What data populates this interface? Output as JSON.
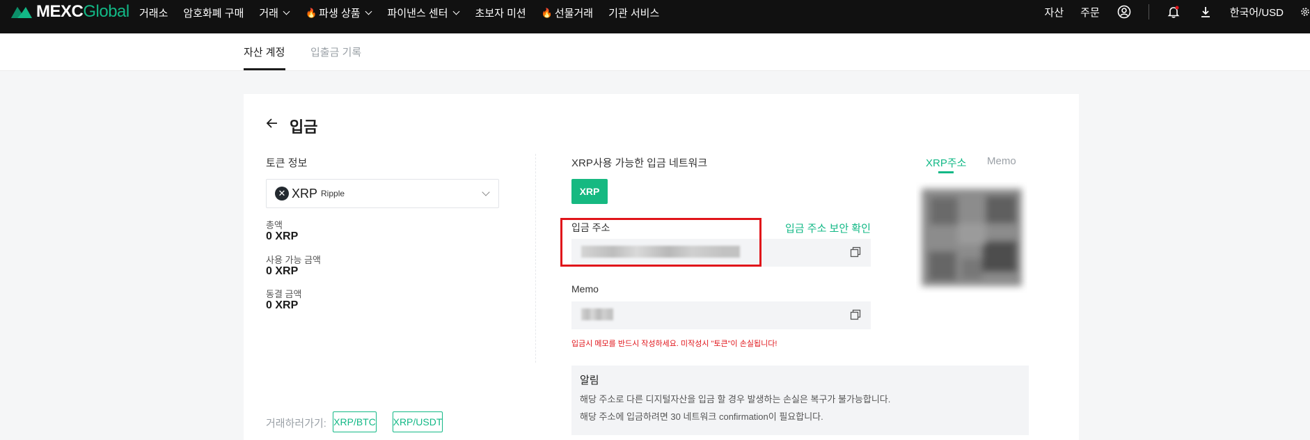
{
  "brand": {
    "name": "MEXC",
    "suffix": "Global"
  },
  "nav": {
    "items": [
      {
        "label": "거래소",
        "fire": false,
        "dropdown": false
      },
      {
        "label": "암호화폐 구매",
        "fire": false,
        "dropdown": false
      },
      {
        "label": "거래",
        "fire": false,
        "dropdown": true
      },
      {
        "label": "파생 상품",
        "fire": true,
        "dropdown": true
      },
      {
        "label": "파이낸스 센터",
        "fire": false,
        "dropdown": true
      },
      {
        "label": "초보자 미션",
        "fire": false,
        "dropdown": false
      },
      {
        "label": "선물거래",
        "fire": true,
        "dropdown": false
      },
      {
        "label": "기관 서비스",
        "fire": false,
        "dropdown": false
      }
    ],
    "right": {
      "assets": "자산",
      "orders": "주문",
      "lang_currency": "한국어/USD"
    }
  },
  "tabs": {
    "active": "자산 계정",
    "inactive": "입출금 기록"
  },
  "page": {
    "title": "입금",
    "token_info_label": "토큰 정보",
    "token": {
      "symbol": "XRP",
      "name": "Ripple"
    },
    "balances": [
      {
        "label": "총액",
        "value": "0 XRP"
      },
      {
        "label": "사용 가능 금액",
        "value": "0 XRP"
      },
      {
        "label": "동결 금액",
        "value": "0 XRP"
      }
    ],
    "trade": {
      "label": "거래하러가기:",
      "pairs": [
        "XRP/BTC",
        "XRP/USDT"
      ]
    },
    "network_label": "XRP사용 가능한 입금 네트워크",
    "network_button": "XRP",
    "address_label": "입금 주소",
    "verify_link": "입금 주소 보안 확인",
    "memo_label": "Memo",
    "memo_warning": "입금시 메모를 반드시 작성하세요. 미작성시 \"토큰\"이 손실됩니다!",
    "notice": {
      "title": "알림",
      "lines": [
        "해당 주소로 다른 디지털자산을 입금 할 경우 발생하는 손실은 복구가 불가능합니다.",
        "해당 주소에 입금하려면 30 네트워크 confirmation이 필요합니다."
      ]
    },
    "qr_tabs": {
      "active": "XRP주소",
      "inactive": "Memo"
    }
  },
  "colors": {
    "accent": "#12b886",
    "warning": "#e0141a",
    "nav_bg": "#111111"
  }
}
